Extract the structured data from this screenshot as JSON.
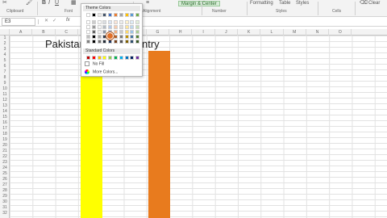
{
  "ribbon": {
    "font_name_value": "",
    "tab_labels": [
      "Formatting",
      "Table",
      "Styles"
    ],
    "group_labels": [
      "Clipboard",
      "Font",
      "Alignment",
      "Number",
      "Styles",
      "Cells"
    ],
    "clear_label": "Clear",
    "style_chip_label": "Margin & Center"
  },
  "formula_bar": {
    "name_box": "E3",
    "fx_label": "fx"
  },
  "columns": [
    "A",
    "B",
    "C",
    "D",
    "E",
    "F",
    "G",
    "H",
    "I",
    "J",
    "K",
    "L",
    "M",
    "N",
    "O"
  ],
  "rows": [
    "1",
    "2",
    "3",
    "4",
    "5",
    "6",
    "7",
    "8",
    "9",
    "10",
    "11",
    "12",
    "13",
    "14",
    "15",
    "16",
    "17",
    "18",
    "19",
    "20",
    "21",
    "22",
    "23",
    "24",
    "25",
    "26",
    "27",
    "28",
    "29",
    "30",
    "31",
    "32"
  ],
  "sheet_text": {
    "title_left": "Pakistan",
    "title_right": "ntry"
  },
  "color_picker": {
    "theme_header": "Theme Colors",
    "standard_header": "Standard Colors",
    "no_fill_label": "No Fill",
    "more_colors_label": "More Colors...",
    "theme_colors": [
      "#ffffff",
      "#000000",
      "#e7e6e6",
      "#44546a",
      "#4472c4",
      "#ed7d31",
      "#a5a5a5",
      "#ffc000",
      "#5b9bd5",
      "#70ad47"
    ],
    "standard_colors": [
      "#c00000",
      "#ff0000",
      "#ffc000",
      "#ffff00",
      "#92d050",
      "#00b050",
      "#00b0f0",
      "#0070c0",
      "#002060",
      "#7030a0"
    ]
  },
  "colors": {
    "yellow_fill": "#ffff00",
    "orange_fill": "#e87b1e"
  }
}
